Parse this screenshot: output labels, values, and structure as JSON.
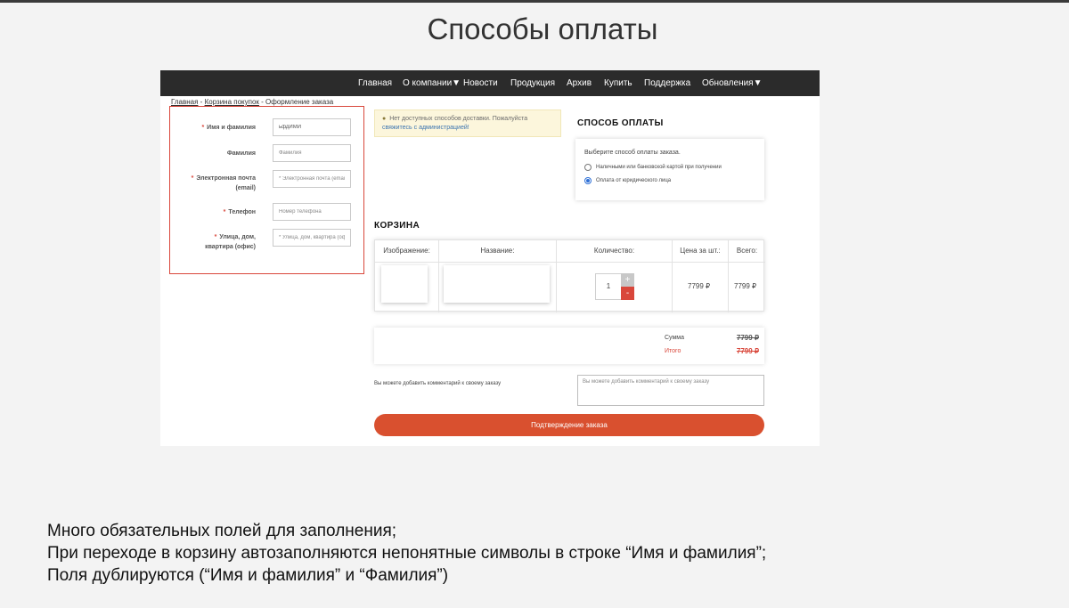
{
  "slide": {
    "title": "Способы оплаты",
    "notes": [
      "Много обязательных полей для заполнения;",
      "При переходе в корзину автозаполняются непонятные символы в строке “Имя и фамилия”;",
      "Поля дублируются (“Имя и фамилия” и “Фамилия”)"
    ]
  },
  "nav": {
    "items": [
      "Главная",
      "О компании▼",
      "Новости",
      "Продукция",
      "Архив",
      "Купить",
      "Поддержка",
      "Обновления▼"
    ]
  },
  "breadcrumb": {
    "home": "Главная",
    "sep": " - ",
    "cart": "Корзина покупок",
    "current": "Оформление заказа"
  },
  "form": {
    "required_mark": "*",
    "name": {
      "label": "Имя и фамилия",
      "value": "ьфдЙМЙ"
    },
    "surname": {
      "label": "Фамилия",
      "placeholder": "Фамилия"
    },
    "email": {
      "label_line1": "Электронная почта",
      "label_line2": "(email)",
      "placeholder": "* Электронная почта (email)"
    },
    "phone": {
      "label": "Телефон",
      "placeholder": "Номер телефона"
    },
    "address": {
      "label_line1": "Улица, дом,",
      "label_line2": "квартира (офис)",
      "placeholder": "* Улица, дом, квартира (офис)"
    }
  },
  "alert": {
    "icon": "info-circle-icon",
    "icon_glyph": "●",
    "text": "Нет доступных способов доставки. Пожалуйста",
    "link": "свяжитесь с администрацией!"
  },
  "payment": {
    "title": "СПОСОБ ОПЛАТЫ",
    "hint": "Выберите способ оплаты заказа.",
    "options": [
      {
        "label": "Наличными или банковской картой при получении",
        "selected": false
      },
      {
        "label": "Оплата от юридического лица",
        "selected": true
      }
    ]
  },
  "cart": {
    "title": "КОРЗИНА",
    "columns": [
      "Изображение:",
      "Название:",
      "Количество:",
      "Цена за шт.:",
      "Всего:"
    ],
    "row": {
      "quantity": "1",
      "plus": "+",
      "minus": "-",
      "price": "7799 ₽",
      "total": "7799 ₽"
    }
  },
  "totals": {
    "sum_label": "Сумма",
    "sum_value": "7799 ₽",
    "total_label": "Итого",
    "total_value": "7799 ₽"
  },
  "comment": {
    "label": "Вы можете добавить комментарий к своему заказу",
    "placeholder": "Вы можете добавить комментарий к своему заказу"
  },
  "confirm": {
    "label": "Подтверждение заказа"
  },
  "colors": {
    "accent": "#d9473b",
    "button": "#d9502f",
    "nav_bg": "#2b2b2b",
    "radio": "#2d6fd6"
  }
}
